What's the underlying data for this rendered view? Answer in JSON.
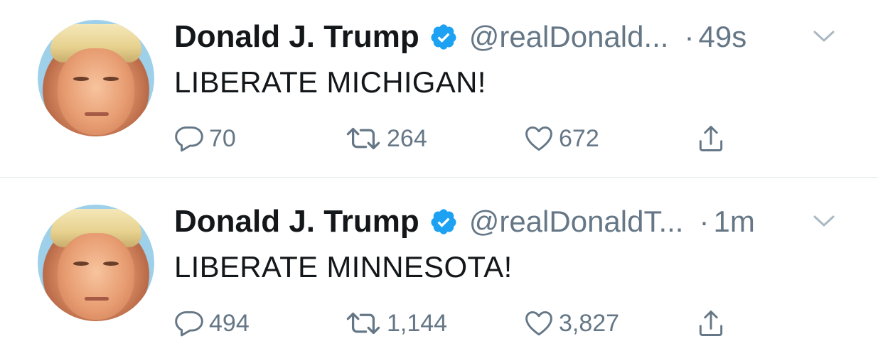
{
  "tweets": [
    {
      "name": "Donald J. Trump",
      "handle": "@realDonald...",
      "time": "49s",
      "text": "LIBERATE MICHIGAN!",
      "replies": "70",
      "retweets": "264",
      "likes": "672"
    },
    {
      "name": "Donald J. Trump",
      "handle": "@realDonaldT...",
      "time": "1m",
      "text": "LIBERATE MINNESOTA!",
      "replies": "494",
      "retweets": "1,144",
      "likes": "3,827"
    }
  ],
  "separator": "·",
  "colors": {
    "verified": "#1da1f2",
    "secondary_text": "#657786",
    "primary_text": "#14171a",
    "divider": "#e1e8ed"
  },
  "icons": {
    "reply": "reply-icon",
    "retweet": "retweet-icon",
    "like": "like-icon",
    "share": "share-icon",
    "verified": "verified-badge-icon",
    "more": "chevron-down-icon"
  }
}
